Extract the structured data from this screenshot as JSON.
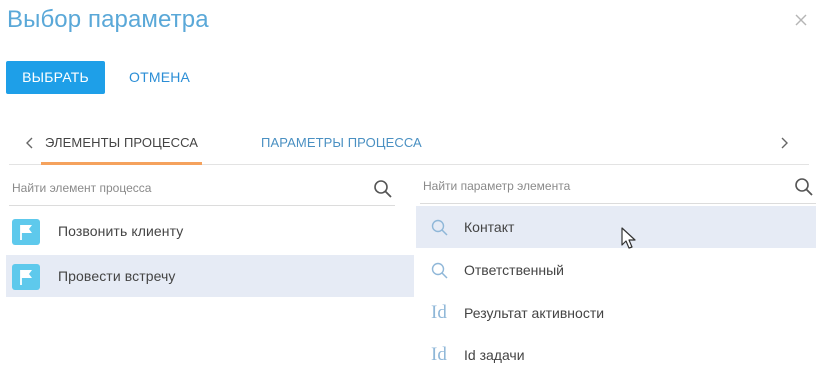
{
  "dialog": {
    "title": "Выбор параметра",
    "close_icon": "close-icon"
  },
  "actions": {
    "select_label": "ВЫБРАТЬ",
    "cancel_label": "ОТМЕНА"
  },
  "tabs": [
    {
      "label": "ЭЛЕМЕНТЫ ПРОЦЕССА",
      "active": true
    },
    {
      "label": "ПАРАМЕТРЫ ПРОЦЕССА",
      "active": false
    }
  ],
  "left_panel": {
    "search_placeholder": "Найти элемент процесса",
    "items": [
      {
        "label": "Позвонить клиенту",
        "icon": "flag-icon",
        "selected": false
      },
      {
        "label": "Провести встречу",
        "icon": "flag-icon",
        "selected": true
      }
    ]
  },
  "right_panel": {
    "search_placeholder": "Найти параметр элемента",
    "items": [
      {
        "label": "Контакт",
        "icon": "lookup-icon",
        "selected": true
      },
      {
        "label": "Ответственный",
        "icon": "lookup-icon",
        "selected": false
      },
      {
        "label": "Результат активности",
        "icon": "id-icon",
        "icon_text": "Id",
        "selected": false
      },
      {
        "label": "Id задачи",
        "icon": "id-icon",
        "icon_text": "Id",
        "selected": false
      }
    ]
  },
  "colors": {
    "accent": "#1e9fe8",
    "title": "#5aa8d8",
    "link": "#2b8ed6",
    "tab_underline": "#f5a25d",
    "selected_row": "#e6ebf5",
    "flag_badge": "#5ec9ec"
  }
}
